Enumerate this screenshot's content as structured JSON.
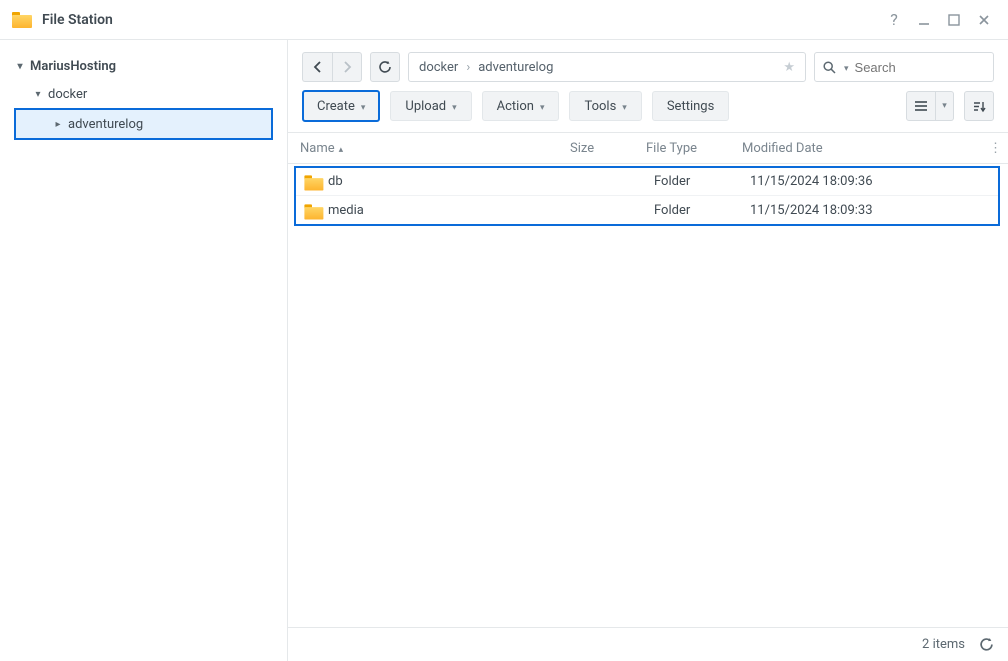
{
  "app_title": "File Station",
  "sidebar": {
    "root": "MariusHosting",
    "l1": "docker",
    "l2": "adventurelog"
  },
  "breadcrumb": [
    "docker",
    "adventurelog"
  ],
  "search_placeholder": "Search",
  "toolbar": {
    "create": "Create",
    "upload": "Upload",
    "action": "Action",
    "tools": "Tools",
    "settings": "Settings"
  },
  "columns": {
    "name": "Name",
    "size": "Size",
    "type": "File Type",
    "date": "Modified Date"
  },
  "rows": [
    {
      "name": "db",
      "type": "Folder",
      "date": "11/15/2024 18:09:36"
    },
    {
      "name": "media",
      "type": "Folder",
      "date": "11/15/2024 18:09:33"
    }
  ],
  "status": "2 items"
}
